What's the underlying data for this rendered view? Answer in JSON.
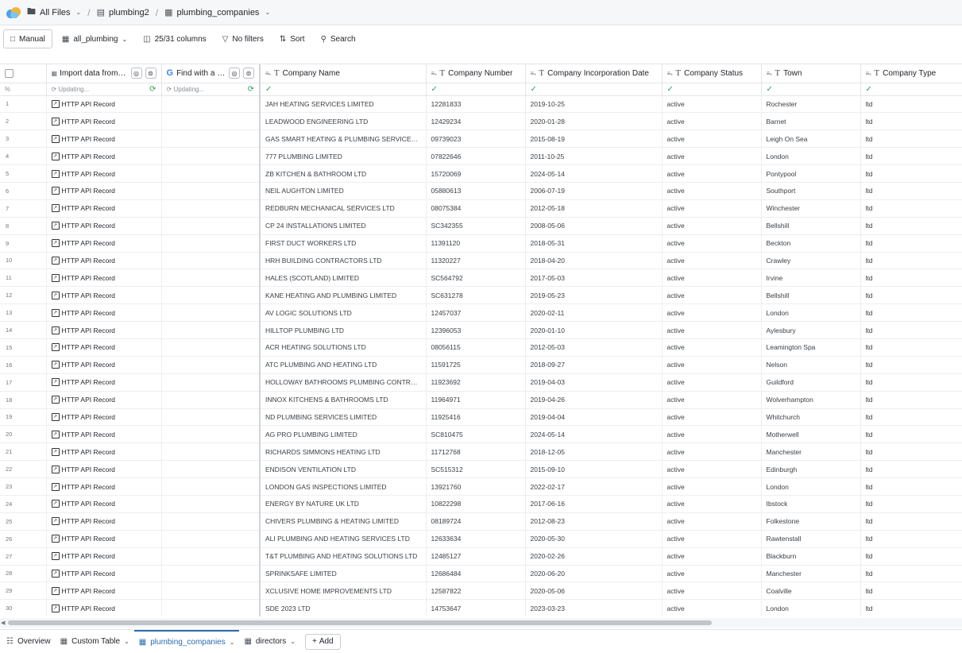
{
  "breadcrumb": {
    "all_files": "All Files",
    "folder": "plumbing2",
    "table": "plumbing_companies"
  },
  "toolbar": {
    "manual": "Manual",
    "view": "all_plumbing",
    "columns": "25/31 columns",
    "filters": "No filters",
    "sort": "Sort",
    "search": "Search"
  },
  "columns": {
    "import": "Import data from an API",
    "find": "Find with a Google search",
    "company_name": "Company Name",
    "company_number": "Company Number",
    "incorporation_date": "Company Incorporation Date",
    "status": "Company Status",
    "town": "Town",
    "type": "Company Type"
  },
  "status_row": {
    "percent": "%",
    "updating": "Updating..."
  },
  "record_label": "HTTP API Record",
  "rows": [
    {
      "n": "1",
      "name": "JAH HEATING SERVICES LIMITED",
      "number": "12281833",
      "date": "2019-10-25",
      "status": "active",
      "town": "Rochester",
      "type": "ltd"
    },
    {
      "n": "2",
      "name": "LEADWOOD ENGINEERING LTD",
      "number": "12429234",
      "date": "2020-01-28",
      "status": "active",
      "town": "Barnet",
      "type": "ltd"
    },
    {
      "n": "3",
      "name": "GAS SMART HEATING & PLUMBING SERVICES LTD",
      "number": "09739023",
      "date": "2015-08-19",
      "status": "active",
      "town": "Leigh On Sea",
      "type": "ltd"
    },
    {
      "n": "4",
      "name": "777 PLUMBING LIMITED",
      "number": "07822646",
      "date": "2011-10-25",
      "status": "active",
      "town": "London",
      "type": "ltd"
    },
    {
      "n": "5",
      "name": "ZB KITCHEN & BATHROOM LTD",
      "number": "15720069",
      "date": "2024-05-14",
      "status": "active",
      "town": "Pontypool",
      "type": "ltd"
    },
    {
      "n": "6",
      "name": "NEIL AUGHTON LIMITED",
      "number": "05880613",
      "date": "2006-07-19",
      "status": "active",
      "town": "Southport",
      "type": "ltd"
    },
    {
      "n": "7",
      "name": "REDBURN MECHANICAL SERVICES LTD",
      "number": "08075384",
      "date": "2012-05-18",
      "status": "active",
      "town": "Winchester",
      "type": "ltd"
    },
    {
      "n": "8",
      "name": "CP 24 INSTALLATIONS LIMITED",
      "number": "SC342355",
      "date": "2008-05-06",
      "status": "active",
      "town": "Bellshill",
      "type": "ltd"
    },
    {
      "n": "9",
      "name": "FIRST DUCT WORKERS LTD",
      "number": "11391120",
      "date": "2018-05-31",
      "status": "active",
      "town": "Beckton",
      "type": "ltd"
    },
    {
      "n": "10",
      "name": "HRH BUILDING CONTRACTORS LTD",
      "number": "11320227",
      "date": "2018-04-20",
      "status": "active",
      "town": "Crawley",
      "type": "ltd"
    },
    {
      "n": "11",
      "name": "HALES (SCOTLAND) LIMITED",
      "number": "SC564792",
      "date": "2017-05-03",
      "status": "active",
      "town": "Irvine",
      "type": "ltd"
    },
    {
      "n": "12",
      "name": "KANE HEATING AND PLUMBING LIMITED",
      "number": "SC631278",
      "date": "2019-05-23",
      "status": "active",
      "town": "Bellshill",
      "type": "ltd"
    },
    {
      "n": "13",
      "name": "AV LOGIC SOLUTIONS LTD",
      "number": "12457037",
      "date": "2020-02-11",
      "status": "active",
      "town": "London",
      "type": "ltd"
    },
    {
      "n": "14",
      "name": "HILLTOP PLUMBING LTD",
      "number": "12396053",
      "date": "2020-01-10",
      "status": "active",
      "town": "Aylesbury",
      "type": "ltd"
    },
    {
      "n": "15",
      "name": "ACR HEATING SOLUTIONS LTD",
      "number": "08056115",
      "date": "2012-05-03",
      "status": "active",
      "town": "Leamington Spa",
      "type": "ltd"
    },
    {
      "n": "16",
      "name": "ATC PLUMBING AND HEATING LTD",
      "number": "11591725",
      "date": "2018-09-27",
      "status": "active",
      "town": "Nelson",
      "type": "ltd"
    },
    {
      "n": "17",
      "name": "HOLLOWAY BATHROOMS PLUMBING CONTRACTORS LTD",
      "number": "11923692",
      "date": "2019-04-03",
      "status": "active",
      "town": "Guildford",
      "type": "ltd"
    },
    {
      "n": "18",
      "name": "INNOX KITCHENS & BATHROOMS LTD",
      "number": "11964971",
      "date": "2019-04-26",
      "status": "active",
      "town": "Wolverhampton",
      "type": "ltd"
    },
    {
      "n": "19",
      "name": "ND PLUMBING SERVICES LIMITED",
      "number": "11925416",
      "date": "2019-04-04",
      "status": "active",
      "town": "Whitchurch",
      "type": "ltd"
    },
    {
      "n": "20",
      "name": "AG PRO PLUMBING LIMITED",
      "number": "SC810475",
      "date": "2024-05-14",
      "status": "active",
      "town": "Motherwell",
      "type": "ltd"
    },
    {
      "n": "21",
      "name": "RICHARDS SIMMONS HEATING LTD",
      "number": "11712768",
      "date": "2018-12-05",
      "status": "active",
      "town": "Manchester",
      "type": "ltd"
    },
    {
      "n": "22",
      "name": "ENDISON VENTILATION LTD",
      "number": "SC515312",
      "date": "2015-09-10",
      "status": "active",
      "town": "Edinburgh",
      "type": "ltd"
    },
    {
      "n": "23",
      "name": "LONDON GAS INSPECTIONS LIMITED",
      "number": "13921760",
      "date": "2022-02-17",
      "status": "active",
      "town": "London",
      "type": "ltd"
    },
    {
      "n": "24",
      "name": "ENERGY BY NATURE UK LTD",
      "number": "10822298",
      "date": "2017-06-16",
      "status": "active",
      "town": "Ibstock",
      "type": "ltd"
    },
    {
      "n": "25",
      "name": "CHIVERS PLUMBING & HEATING LIMITED",
      "number": "08189724",
      "date": "2012-08-23",
      "status": "active",
      "town": "Folkestone",
      "type": "ltd"
    },
    {
      "n": "26",
      "name": "ALI PLUMBING AND HEATING SERVICES LTD",
      "number": "12633634",
      "date": "2020-05-30",
      "status": "active",
      "town": "Rawtenstall",
      "type": "ltd"
    },
    {
      "n": "27",
      "name": "T&T PLUMBING AND HEATING SOLUTIONS LTD",
      "number": "12485127",
      "date": "2020-02-26",
      "status": "active",
      "town": "Blackburn",
      "type": "ltd"
    },
    {
      "n": "28",
      "name": "SPRINKSAFE LIMITED",
      "number": "12686484",
      "date": "2020-06-20",
      "status": "active",
      "town": "Manchester",
      "type": "ltd"
    },
    {
      "n": "29",
      "name": "XCLUSIVE HOME IMPROVEMENTS LTD",
      "number": "12587822",
      "date": "2020-05-06",
      "status": "active",
      "town": "Coalville",
      "type": "ltd"
    },
    {
      "n": "30",
      "name": "SDE 2023 LTD",
      "number": "14753647",
      "date": "2023-03-23",
      "status": "active",
      "town": "London",
      "type": "ltd"
    }
  ],
  "tabs": {
    "overview": "Overview",
    "custom_table": "Custom Table",
    "plumbing_companies": "plumbing_companies",
    "directors": "directors",
    "add": "Add"
  },
  "colors": {
    "accent": "#2b6cb0",
    "success": "#2e9e5b"
  }
}
